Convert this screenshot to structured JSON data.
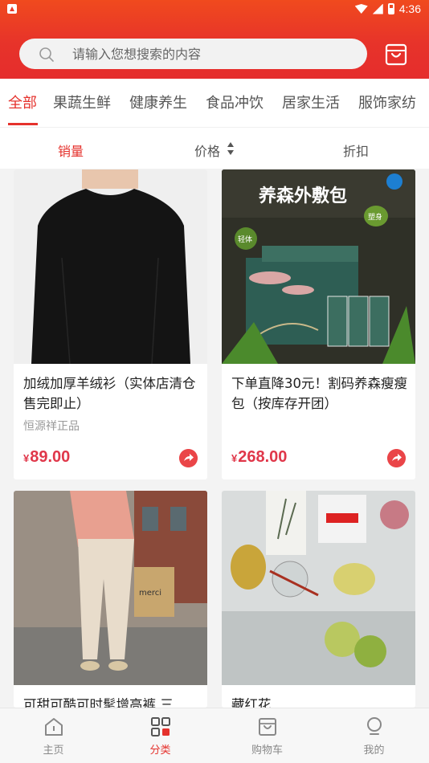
{
  "status_bar": {
    "time": "4:36"
  },
  "search": {
    "placeholder": "请输入您想搜索的内容"
  },
  "categories": [
    "全部",
    "果蔬生鲜",
    "健康养生",
    "食品冲饮",
    "居家生活",
    "服饰家纺"
  ],
  "active_category": "全部",
  "sort": {
    "sales": "销量",
    "price": "价格",
    "discount": "折扣",
    "active": "销量"
  },
  "products": [
    {
      "title": "加绒加厚羊绒衫（实体店清仓售完即止）",
      "subtitle": "恒源祥正品",
      "currency": "¥",
      "price": "89.00"
    },
    {
      "title": "下单直降30元！割码养森瘦瘦包（按库存开团）",
      "subtitle": "",
      "currency": "¥",
      "price": "268.00",
      "image_text": "养森外敷包",
      "badge_1": "轻体",
      "badge_2": "塑身"
    },
    {
      "title": "可甜可酷可时髦增高裤 三",
      "subtitle": "",
      "currency": "",
      "price": "",
      "bag_text": "merci"
    },
    {
      "title": "藏红花",
      "subtitle": "",
      "currency": "",
      "price": ""
    }
  ],
  "bottom_nav": [
    {
      "label": "主页",
      "icon": "home-icon"
    },
    {
      "label": "分类",
      "icon": "category-icon"
    },
    {
      "label": "购物车",
      "icon": "cart-icon"
    },
    {
      "label": "我的",
      "icon": "profile-icon"
    }
  ],
  "active_nav": "分类",
  "colors": {
    "brand": "#e5322d",
    "price": "#e0374a",
    "header_gradient_top": "#f04a1e"
  }
}
